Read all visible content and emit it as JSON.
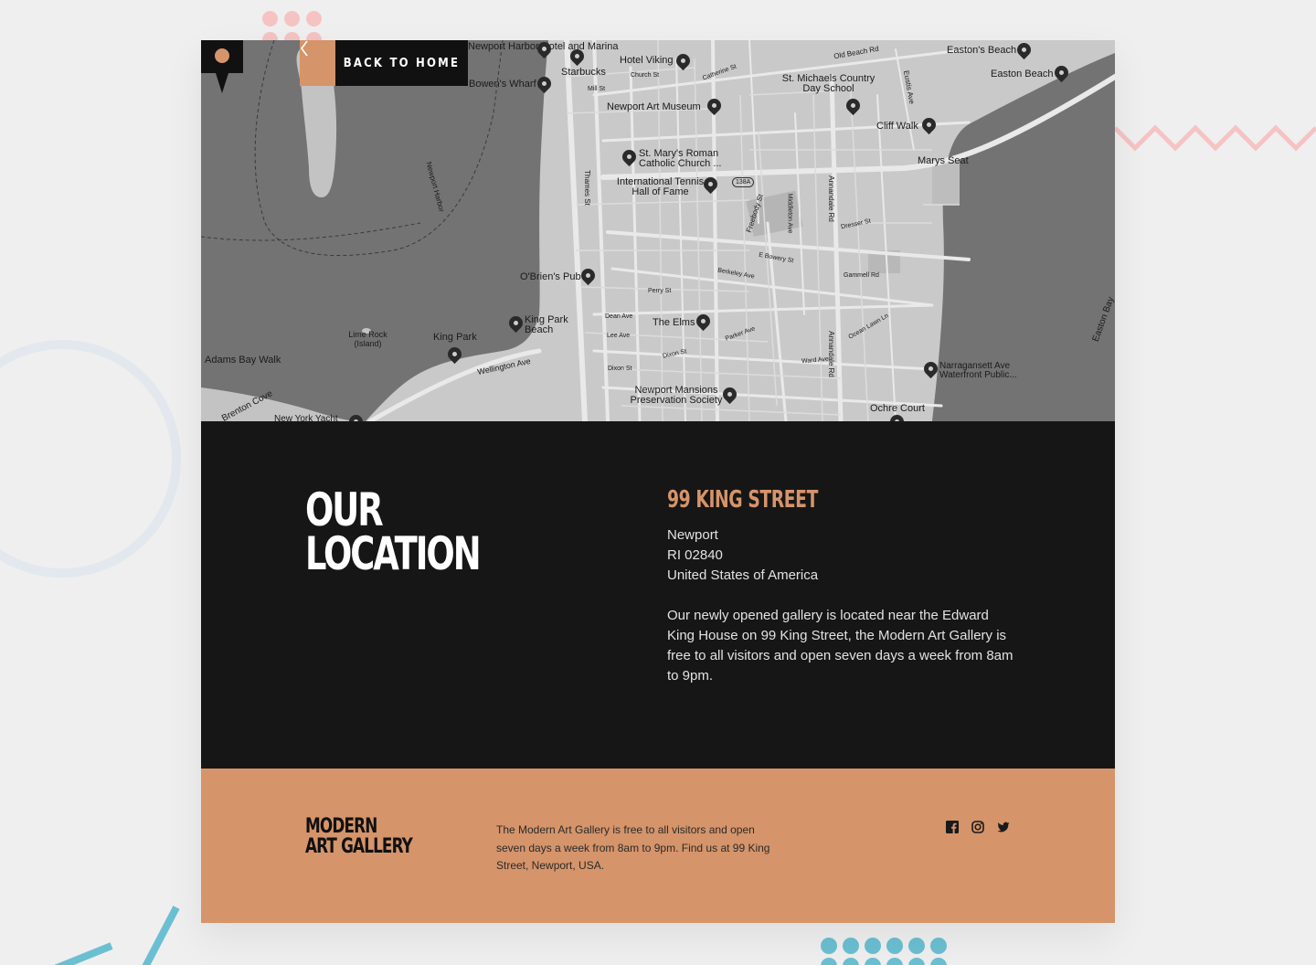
{
  "nav": {
    "back_label": "BACK TO HOME"
  },
  "map": {
    "labels": {
      "newport_harbor_hotel": "Newport Harbor Hotel and Marina",
      "hotel_viking": "Hotel Viking",
      "starbucks": "Starbucks",
      "bowens_wharf": "Bowen's Wharf",
      "newport_art_museum": "Newport Art Museum",
      "st_marys": "St. Mary's Roman Catholic Church ...",
      "tennis_hof": "International Tennis Hall of Fame",
      "st_michaels": "St. Michaels Country Day School",
      "eastons_beach": "Easton's Beach",
      "easton_beach": "Easton Beach",
      "cliff_walk": "Cliff Walk",
      "marys_seat": "Marys Seat",
      "obriens_pub": "O'Brien's Pub",
      "king_park_beach": "King Park Beach",
      "king_park": "King Park",
      "lime_rock": "Lime Rock (Island)",
      "the_elms": "The Elms",
      "adams_bay_walk": "Adams Bay Walk",
      "brenton_cove": "Brenton Cove",
      "wellington_ave": "Wellington Ave",
      "newport_mansions": "Newport Mansions Preservation Society",
      "narragansett": "Narragansett Ave Waterfront Public...",
      "ochre_court": "Ochre Court",
      "easton_bay": "Easton Bay",
      "newport_harbor": "Newport Harbor",
      "new_york_yacht": "New York Yacht",
      "thames_st": "Thames St",
      "perry_st": "Perry St",
      "berkeley_ave": "Berkeley Ave",
      "e_bowery_st": "E Bowery St",
      "annandale_rd": "Annandale Rd",
      "old_beach_rd": "Old Beach Rd",
      "eustis_ave": "Eustis Ave",
      "dresser_st": "Dresser St",
      "gammell_rd": "Gammell Rd",
      "freebody_st": "Freebody St",
      "ward_ave": "Ward Ave",
      "parker_ave": "Parker Ave",
      "dixon_st": "Dixon St",
      "church_st": "Church St",
      "mill_st": "Mill St",
      "route": "138A",
      "dean_ave": "Dean Ave",
      "lee_ave": "Lee Ave",
      "catherine_st": "Catherine St",
      "middleton_ave": "Middleton Ave",
      "ocean_lawn_ln": "Ocean Lawn Ln"
    }
  },
  "location": {
    "heading_line1": "OUR",
    "heading_line2": "LOCATION",
    "street": "99 KING STREET",
    "city": "Newport",
    "state_zip": "RI 02840",
    "country": "United States of America",
    "description": "Our newly opened gallery is located near the Edward King House on 99 King Street, the Modern Art Gallery is free to all visitors and open seven days a week from 8am to 9pm."
  },
  "footer": {
    "brand_line1": "MODERN",
    "brand_line2": "ART GALLERY",
    "text": "The Modern Art Gallery is free to all visitors and open seven days a week from 8am to 9pm. Find us at 99 King Street, Newport, USA.",
    "socials": [
      "facebook-icon",
      "instagram-icon",
      "twitter-icon"
    ]
  },
  "colors": {
    "accent": "#d5946a",
    "dark": "#161616",
    "background": "#efefef"
  }
}
